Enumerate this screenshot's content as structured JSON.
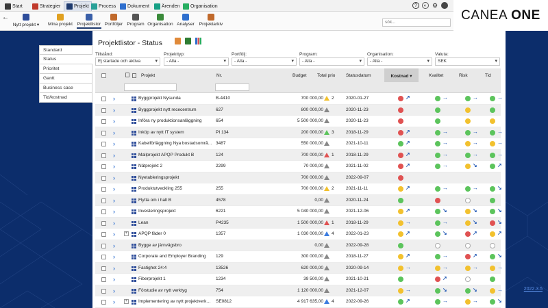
{
  "top_tabs": [
    {
      "label": "Start",
      "icon": "home-icon",
      "color": "#3a3a3a"
    },
    {
      "label": "Strategier",
      "icon": "strategy-icon",
      "color": "#c0392b"
    },
    {
      "label": "Projekt",
      "icon": "project-icon",
      "color": "#1e3a6e"
    },
    {
      "label": "Process",
      "icon": "process-icon",
      "color": "#2aa198"
    },
    {
      "label": "Dokument",
      "icon": "document-icon",
      "color": "#2e6fce"
    },
    {
      "label": "Ärenden",
      "icon": "case-icon",
      "color": "#16a085"
    },
    {
      "label": "Organisation",
      "icon": "organisation-icon",
      "color": "#27ae60"
    }
  ],
  "brand": {
    "name": "CANEA",
    "bold": "ONE"
  },
  "toolbar": {
    "items": [
      {
        "label": "Nytt projekt ▾",
        "icon": "new-project-icon"
      },
      {
        "label": "Mina projekt",
        "icon": "star-icon"
      },
      {
        "label": "Projektlistor",
        "icon": "list-icon"
      },
      {
        "label": "Portföljer",
        "icon": "portfolio-icon"
      },
      {
        "label": "Program",
        "icon": "program-icon"
      },
      {
        "label": "Organisation",
        "icon": "organisation-icon"
      },
      {
        "label": "Analyser",
        "icon": "chart-icon"
      },
      {
        "label": "Projektarkiv",
        "icon": "archive-icon"
      }
    ],
    "search_placeholder": "sök..."
  },
  "left_nav": [
    "Standard",
    "Status",
    "Prioritet",
    "Gantt",
    "Business case",
    "Tid/kostnad"
  ],
  "page": {
    "title": "Projektlistor - Status"
  },
  "filters": [
    {
      "label": "Tillstånd:",
      "value": "Ej startade och aktiva"
    },
    {
      "label": "Projekttyp:",
      "value": "- Alla -"
    },
    {
      "label": "Portfölj:",
      "value": "- Alla -"
    },
    {
      "label": "Program:",
      "value": "- Alla -"
    },
    {
      "label": "Organisation:",
      "value": "- Alla -"
    },
    {
      "label": "Valuta:",
      "value": "SEK"
    }
  ],
  "columns": {
    "projekt": "Projekt",
    "nr": "Nr.",
    "budget": "Budget",
    "prio": "Total prio",
    "date": "Statusdatum",
    "kostnad": "Kostnad",
    "kvalitet": "Kvalitet",
    "risk": "Risk",
    "tid": "Tid"
  },
  "version": "2022.3.5",
  "status_colors": {
    "r": "#e05252",
    "y": "#f2c12e",
    "g": "#5cc45c",
    "e": "#ffffff"
  },
  "rows": [
    {
      "name": "Byggprojekt Nysunda",
      "nr": "B-4410",
      "budget": "700 000,00",
      "prio": "2",
      "prio_color": "#f2c12e",
      "date": "2020-01-27",
      "k": "r",
      "kt": "↗",
      "q": "g",
      "qt": "→",
      "r": "g",
      "rt": "→",
      "t": "g",
      "tt": "→",
      "expand": false
    },
    {
      "name": "Byggprojekt nytt rececentrum",
      "nr": "627",
      "budget": "800 000,00",
      "prio": "",
      "prio_color": "#888888",
      "date": "2020-11-23",
      "k": "r",
      "kt": "",
      "q": "g",
      "qt": "",
      "r": "y",
      "rt": "",
      "t": "g",
      "tt": "",
      "expand": false
    },
    {
      "name": "Införa ny produktionsanläggning",
      "nr": "654",
      "budget": "5 500 000,00",
      "prio": "",
      "prio_color": "#888888",
      "date": "2020-11-23",
      "k": "r",
      "kt": "",
      "q": "g",
      "qt": "",
      "r": "y",
      "rt": "",
      "t": "y",
      "tt": "",
      "expand": false
    },
    {
      "name": "Inköp av nytt IT system",
      "nr": "PI 134",
      "budget": "200 000,00",
      "prio": "3",
      "prio_color": "#5cc45c",
      "date": "2018-11-29",
      "k": "r",
      "kt": "↗",
      "q": "g",
      "qt": "→",
      "r": "g",
      "rt": "→",
      "t": "g",
      "tt": "→",
      "expand": false
    },
    {
      "name": "Kabelförläggning Nya bostadsområ…",
      "nr": "3487",
      "budget": "550 000,00",
      "prio": "",
      "prio_color": "#888888",
      "date": "2021-10-11",
      "k": "g",
      "kt": "↗",
      "q": "g",
      "qt": "→",
      "r": "y",
      "rt": "→",
      "t": "y",
      "tt": "→",
      "expand": false
    },
    {
      "name": "Mallprojekt APQP Produkt B",
      "nr": "124",
      "budget": "700 000,00",
      "prio": "1",
      "prio_color": "#e05252",
      "date": "2018-11-29",
      "k": "r",
      "kt": "↗",
      "q": "g",
      "qt": "→",
      "r": "g",
      "rt": "→",
      "t": "g",
      "tt": "→",
      "expand": false
    },
    {
      "name": "Nätprojekt 2",
      "nr": "2299",
      "budget": "70 000,00",
      "prio": "",
      "prio_color": "#888888",
      "date": "2021-11-02",
      "k": "r",
      "kt": "↗",
      "q": "g",
      "qt": "→",
      "r": "y",
      "rt": "↘",
      "t": "g",
      "tt": "↗",
      "expand": false
    },
    {
      "name": "Nyetableringsprojekt",
      "nr": "",
      "budget": "700 000,00",
      "prio": "",
      "prio_color": "#888888",
      "date": "2022-09-07",
      "k": "r",
      "kt": "",
      "q": "",
      "qt": "",
      "r": "",
      "rt": "",
      "t": "",
      "tt": "",
      "expand": false
    },
    {
      "name": "Produktutveckling 255",
      "nr": "255",
      "budget": "700 000,00",
      "prio": "2",
      "prio_color": "#f2c12e",
      "date": "2021-11-11",
      "k": "y",
      "kt": "↗",
      "q": "g",
      "qt": "→",
      "r": "g",
      "rt": "→",
      "t": "g",
      "tt": "↘",
      "expand": false
    },
    {
      "name": "Flytta om i hall B",
      "nr": "4578",
      "budget": "0,00",
      "prio": "",
      "prio_color": "#888888",
      "date": "2020-11-24",
      "k": "g",
      "kt": "",
      "q": "r",
      "qt": "",
      "r": "e",
      "rt": "",
      "t": "g",
      "tt": "",
      "expand": false
    },
    {
      "name": "Investeringsprojekt",
      "nr": "6221",
      "budget": "5 040 000,00",
      "prio": "",
      "prio_color": "#888888",
      "date": "2021-12-06",
      "k": "y",
      "kt": "↗",
      "q": "g",
      "qt": "↘",
      "r": "y",
      "rt": "↘",
      "t": "g",
      "tt": "↘",
      "expand": false
    },
    {
      "name": "Lean",
      "nr": "P4235",
      "budget": "1 500 000,00",
      "prio": "1",
      "prio_color": "#e05252",
      "date": "2018-11-29",
      "k": "y",
      "kt": "→",
      "q": "g",
      "qt": "→",
      "r": "y",
      "rt": "↘",
      "t": "r",
      "tt": "↘",
      "expand": false
    },
    {
      "name": "APQP fäder 0",
      "nr": "1357",
      "budget": "1 030 000,00",
      "prio": "4",
      "prio_color": "#3d7de0",
      "date": "2022-01-23",
      "k": "y",
      "kt": "↗",
      "q": "g",
      "qt": "↘",
      "r": "r",
      "rt": "↗",
      "t": "y",
      "tt": "↗",
      "expand": true
    },
    {
      "name": "Bygge av järnvägsbro",
      "nr": "",
      "budget": "0,00",
      "prio": "",
      "prio_color": "#888888",
      "date": "2022-09-28",
      "k": "g",
      "kt": "",
      "q": "e",
      "qt": "",
      "r": "e",
      "rt": "",
      "t": "e",
      "tt": "",
      "expand": false
    },
    {
      "name": "Corporate and Employer Branding",
      "nr": "129",
      "budget": "300 000,00",
      "prio": "",
      "prio_color": "#888888",
      "date": "2018-11-27",
      "k": "y",
      "kt": "↗",
      "q": "g",
      "qt": "→",
      "r": "r",
      "rt": "↗",
      "t": "g",
      "tt": "↘",
      "expand": false
    },
    {
      "name": "Fastighet 24:4",
      "nr": "13526",
      "budget": "620 000,00",
      "prio": "",
      "prio_color": "#888888",
      "date": "2020-09-14",
      "k": "y",
      "kt": "→",
      "q": "y",
      "qt": "→",
      "r": "y",
      "rt": "→",
      "t": "y",
      "tt": "→",
      "expand": false
    },
    {
      "name": "Fiberprojekt 1",
      "nr": "1234",
      "budget": "39 500,00",
      "prio": "",
      "prio_color": "#888888",
      "date": "2021-10-21",
      "k": "g",
      "kt": "",
      "q": "r",
      "qt": "↗",
      "r": "e",
      "rt": "",
      "t": "g",
      "tt": "",
      "expand": false
    },
    {
      "name": "Förstudie av nytt verktyg",
      "nr": "754",
      "budget": "1 120 000,00",
      "prio": "",
      "prio_color": "#888888",
      "date": "2021-12-07",
      "k": "y",
      "kt": "→",
      "q": "g",
      "qt": "↘",
      "r": "g",
      "rt": "↘",
      "t": "y",
      "tt": "→",
      "expand": false
    },
    {
      "name": "Implementering av nytt projektverk…",
      "nr": "SE0812",
      "budget": "4 917 635,00",
      "prio": "4",
      "prio_color": "#3d7de0",
      "date": "2022-09-26",
      "k": "g",
      "kt": "↗",
      "q": "g",
      "qt": "→",
      "r": "y",
      "rt": "→",
      "t": "g",
      "tt": "↘",
      "expand": true
    }
  ]
}
